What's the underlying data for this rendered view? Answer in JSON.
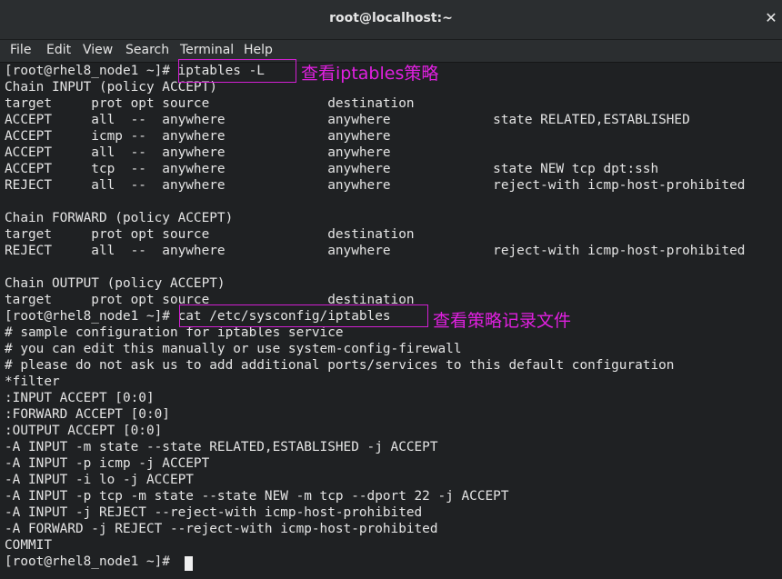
{
  "window": {
    "title": "root@localhost:~",
    "close_glyph": "✕"
  },
  "menu": [
    "File",
    "Edit",
    "View",
    "Search",
    "Terminal",
    "Help"
  ],
  "terminal": {
    "lines": [
      "[root@rhel8_node1 ~]# iptables -L",
      "Chain INPUT (policy ACCEPT)",
      "target     prot opt source               destination",
      "ACCEPT     all  --  anywhere             anywhere             state RELATED,ESTABLISHED",
      "ACCEPT     icmp --  anywhere             anywhere",
      "ACCEPT     all  --  anywhere             anywhere",
      "ACCEPT     tcp  --  anywhere             anywhere             state NEW tcp dpt:ssh",
      "REJECT     all  --  anywhere             anywhere             reject-with icmp-host-prohibited",
      "",
      "Chain FORWARD (policy ACCEPT)",
      "target     prot opt source               destination",
      "REJECT     all  --  anywhere             anywhere             reject-with icmp-host-prohibited",
      "",
      "Chain OUTPUT (policy ACCEPT)",
      "target     prot opt source               destination",
      "[root@rhel8_node1 ~]# cat /etc/sysconfig/iptables",
      "# sample configuration for iptables service",
      "# you can edit this manually or use system-config-firewall",
      "# please do not ask us to add additional ports/services to this default configuration",
      "*filter",
      ":INPUT ACCEPT [0:0]",
      ":FORWARD ACCEPT [0:0]",
      ":OUTPUT ACCEPT [0:0]",
      "-A INPUT -m state --state RELATED,ESTABLISHED -j ACCEPT",
      "-A INPUT -p icmp -j ACCEPT",
      "-A INPUT -i lo -j ACCEPT",
      "-A INPUT -p tcp -m state --state NEW -m tcp --dport 22 -j ACCEPT",
      "-A INPUT -j REJECT --reject-with icmp-host-prohibited",
      "-A FORWARD -j REJECT --reject-with icmp-host-prohibited",
      "COMMIT",
      "[root@rhel8_node1 ~]# "
    ]
  },
  "annotations": {
    "note1": "查看iptables策略",
    "note2": "查看策略记录文件"
  },
  "colors": {
    "annotation": "#d21fd2",
    "background": "#1f2123",
    "text": "#e4e4e4"
  }
}
